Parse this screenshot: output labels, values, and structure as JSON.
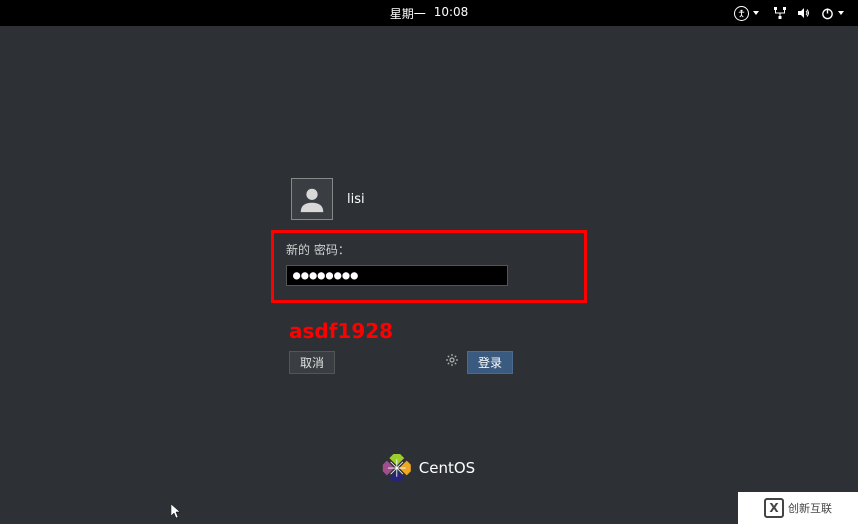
{
  "topbar": {
    "day": "星期一",
    "time": "10:08"
  },
  "login": {
    "username": "lisi",
    "password_label": "新的 密码：",
    "password_value": "●●●●●●●●",
    "cancel_label": "取消",
    "login_label": "登录"
  },
  "annotation": {
    "text": "asdf1928"
  },
  "brand": {
    "name": "CentOS"
  },
  "watermark": {
    "text": "创新互联"
  }
}
